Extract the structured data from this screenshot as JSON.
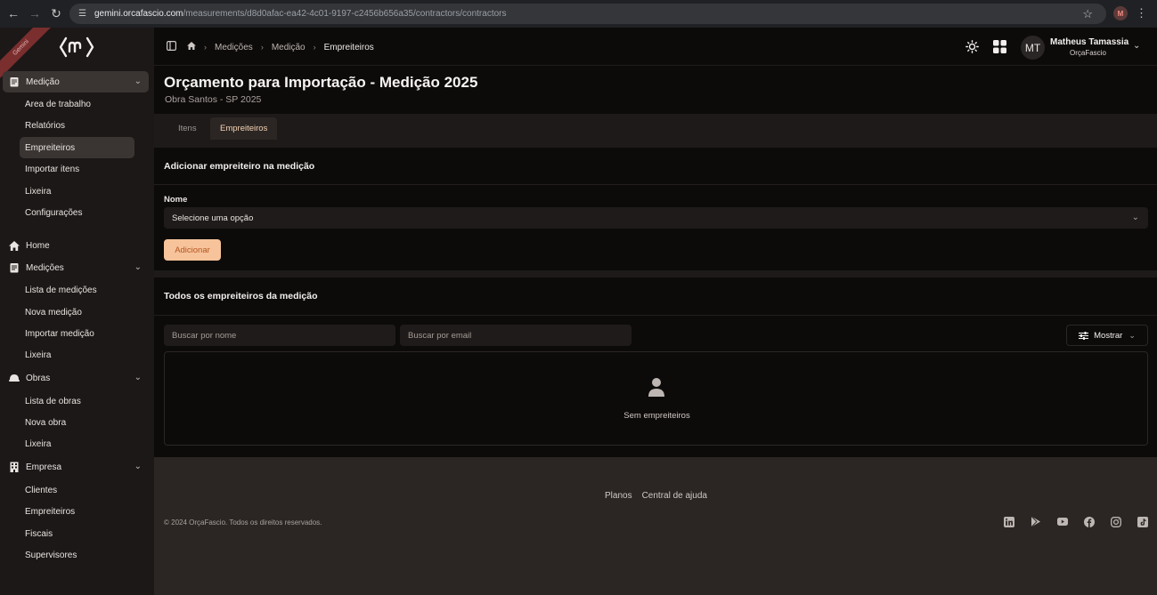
{
  "browser": {
    "url_host": "gemini.orcafascio.com",
    "url_path": "/measurements/d8d0afac-ea42-4c01-9197-c2456b656a35/contractors/contractors",
    "profile_initial": "M"
  },
  "sidebar": {
    "ribbon": "Gemini",
    "sections": [
      {
        "label": "Medição",
        "icon": "clipboard-icon",
        "items": [
          "Area de trabalho",
          "Relatórios",
          "Empreiteiros",
          "Importar itens",
          "Lixeira",
          "Configurações"
        ]
      },
      {
        "label": "Home",
        "icon": "home-icon"
      },
      {
        "label": "Medições",
        "icon": "clipboard-icon",
        "items": [
          "Lista de medições",
          "Nova medição",
          "Importar medição",
          "Lixeira"
        ]
      },
      {
        "label": "Obras",
        "icon": "helmet-icon",
        "items": [
          "Lista de obras",
          "Nova obra",
          "Lixeira"
        ]
      },
      {
        "label": "Empresa",
        "icon": "building-icon",
        "items": [
          "Clientes",
          "Empreiteiros",
          "Fiscais",
          "Supervisores"
        ]
      }
    ]
  },
  "breadcrumb": [
    "Medições",
    "Medição",
    "Empreiteiros"
  ],
  "user": {
    "initials": "MT",
    "name": "Matheus Tamassia",
    "org": "OrçaFascio"
  },
  "page": {
    "title": "Orçamento para Importação - Medição 2025",
    "subtitle": "Obra Santos - SP 2025"
  },
  "tabs": [
    "Itens",
    "Empreiteiros"
  ],
  "add_card": {
    "title": "Adicionar empreiteiro na medição",
    "field_label": "Nome",
    "select_value": "Selecione uma opção",
    "button": "Adicionar"
  },
  "list_card": {
    "title": "Todos os empreiteiros da medição",
    "search_name_placeholder": "Buscar por nome",
    "search_email_placeholder": "Buscar por email",
    "show_button": "Mostrar",
    "empty_text": "Sem empreiteiros"
  },
  "footer": {
    "links": [
      "Planos",
      "Central de ajuda"
    ],
    "copyright": "© 2024 OrçaFascio. Todos os direitos reservados.",
    "socials": [
      "linkedin-icon",
      "play-icon",
      "youtube-icon",
      "facebook-icon",
      "instagram-icon",
      "tiktok-icon"
    ]
  },
  "colors": {
    "accent": "#f7c39b",
    "accent_text": "#b3561f",
    "active_tab_text": "#f6d3b4"
  }
}
